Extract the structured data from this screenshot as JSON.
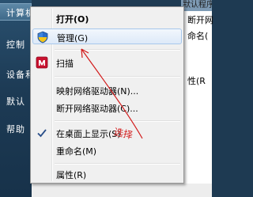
{
  "background_left": {
    "items": [
      "计算机",
      "控制",
      "设备和",
      "默认",
      "帮助"
    ]
  },
  "background_right": {
    "title": "默认程序",
    "items": [
      "断开网",
      "命名(",
      "性(R"
    ]
  },
  "context_menu": {
    "items": [
      {
        "label": "打开(O)",
        "bold": true,
        "icon": "none"
      },
      {
        "label": "管理(G)",
        "bold": false,
        "icon": "shield-icon"
      },
      {
        "label": "扫描",
        "bold": false,
        "icon": "antivirus-scan-icon"
      },
      {
        "label": "映射网络驱动器(N)...",
        "bold": false,
        "icon": "none"
      },
      {
        "label": "断开网络驱动器(C)...",
        "bold": false,
        "icon": "none"
      },
      {
        "label": "在桌面上显示(S)",
        "bold": false,
        "icon": "checkmark-icon",
        "checked": true
      },
      {
        "label": "重命名(M)",
        "bold": false,
        "icon": "none"
      },
      {
        "label": "属性(R)",
        "bold": false,
        "icon": "none"
      }
    ]
  },
  "annotation": {
    "text": "选择",
    "color": "#d21b1b"
  }
}
